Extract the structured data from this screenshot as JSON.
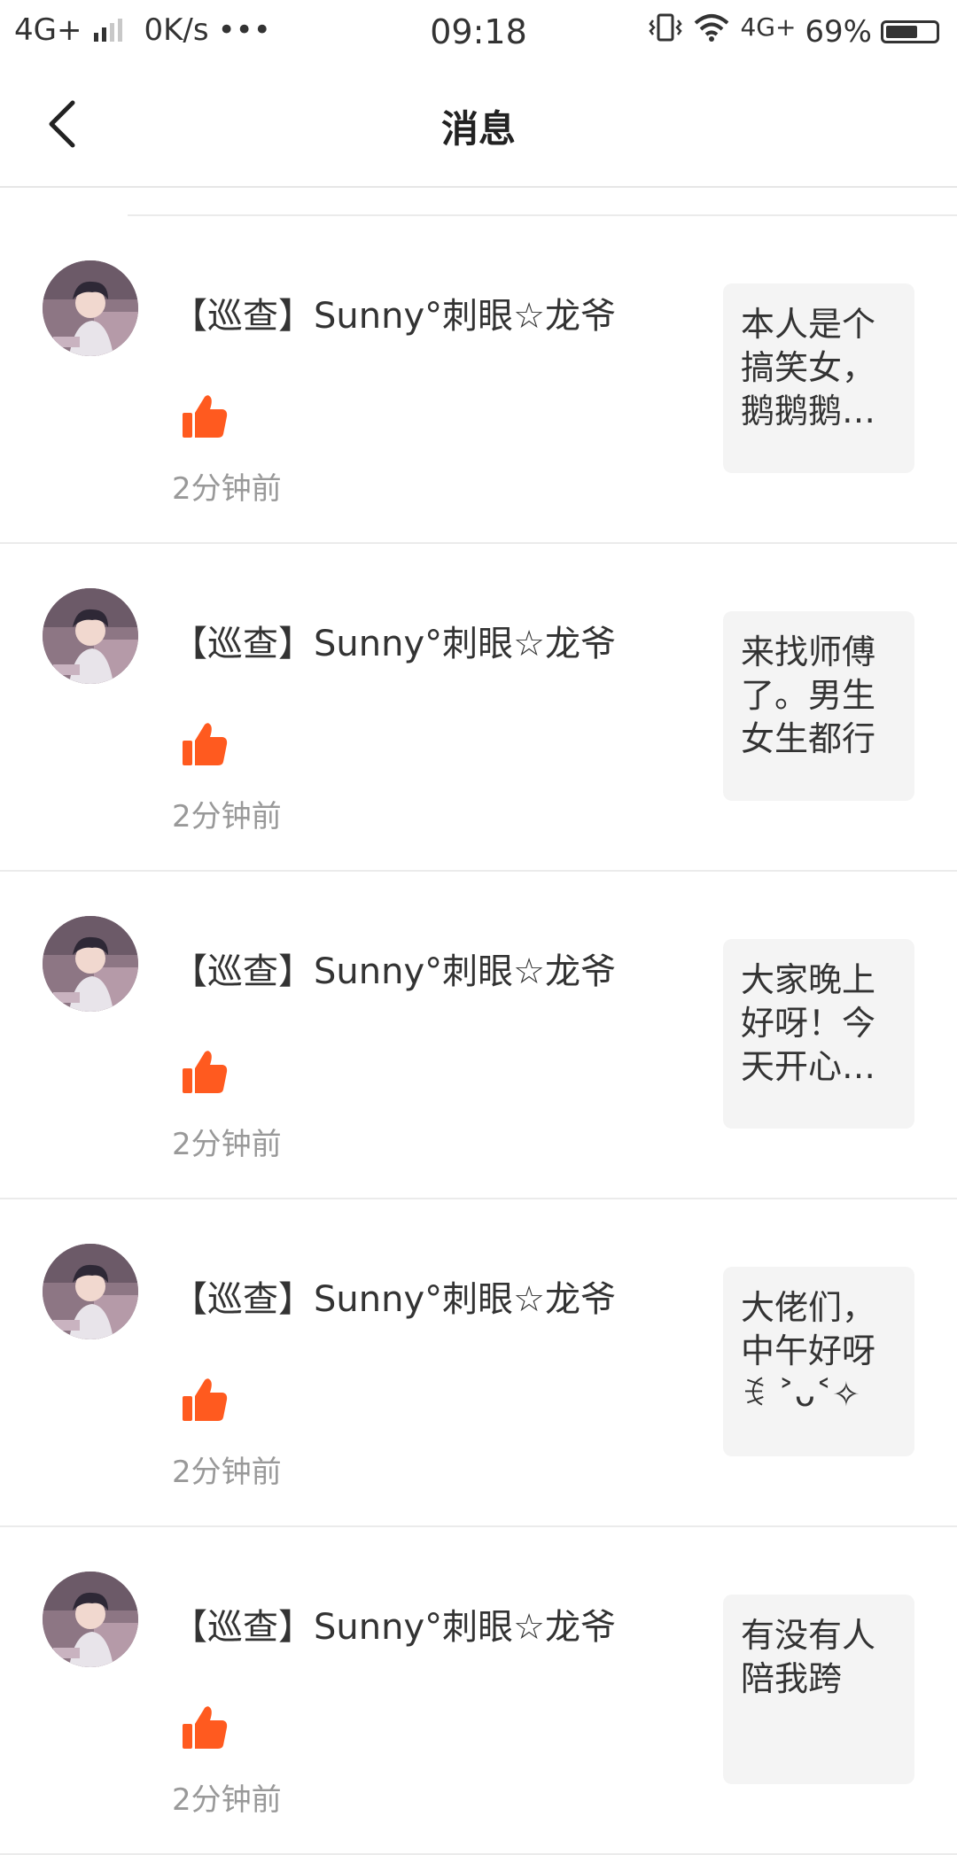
{
  "status_bar": {
    "network": "4G+",
    "speed": "0K/s",
    "more": "•••",
    "time": "09:18",
    "wifi_network": "4G+",
    "battery": "69%",
    "battery_level": 0.69
  },
  "header": {
    "title": "消息"
  },
  "messages": [
    {
      "name": "【巡查】Sunny°刺眼☆龙爷",
      "time": "2分钟前",
      "preview": "本人是个搞笑女，鹅鹅鹅…"
    },
    {
      "name": "【巡查】Sunny°刺眼☆龙爷",
      "time": "2分钟前",
      "preview": "来找师傅了。男生女生都行"
    },
    {
      "name": "【巡查】Sunny°刺眼☆龙爷",
      "time": "2分钟前",
      "preview": "大家晚上好呀！今天开心…"
    },
    {
      "name": "【巡查】Sunny°刺眼☆龙爷",
      "time": "2分钟前",
      "preview": "大佬们，中午好呀ꉂ ˃ᴗ˂✧"
    },
    {
      "name": "【巡查】Sunny°刺眼☆龙爷",
      "time": "2分钟前",
      "preview": "有没有人陪我跨"
    }
  ],
  "colors": {
    "like": "#ff5a1f",
    "preview_bg": "#f4f4f4",
    "time_text": "#999999"
  },
  "icons": {
    "back": "chevron-left-icon",
    "like": "thumbs-up-icon",
    "wifi": "wifi-icon",
    "vibrate": "vibrate-icon",
    "battery": "battery-icon"
  }
}
